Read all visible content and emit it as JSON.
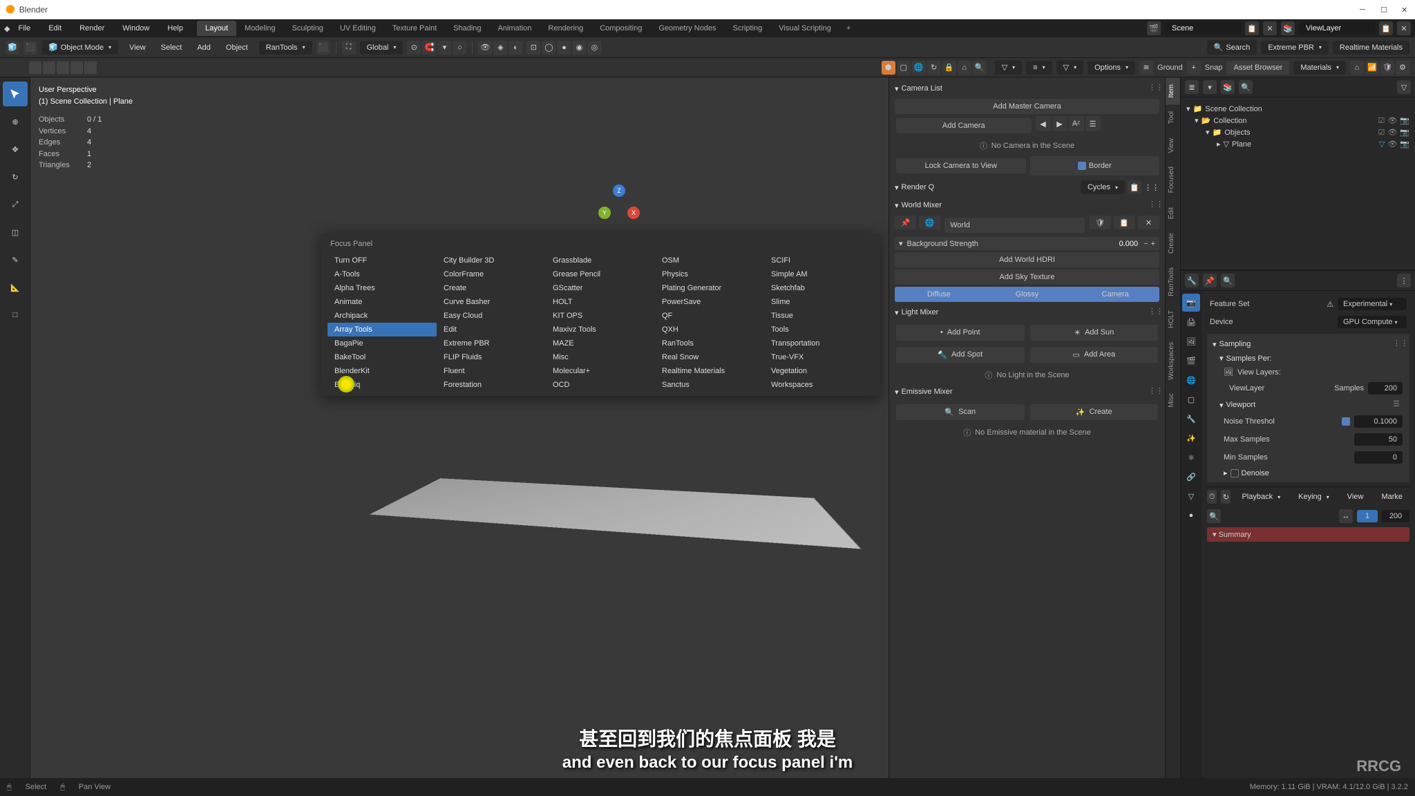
{
  "app": {
    "title": "Blender"
  },
  "menubar": [
    "File",
    "Edit",
    "Render",
    "Window",
    "Help"
  ],
  "workspace_tabs": [
    "Layout",
    "Modeling",
    "Sculpting",
    "UV Editing",
    "Texture Paint",
    "Shading",
    "Animation",
    "Rendering",
    "Compositing",
    "Geometry Nodes",
    "Scripting",
    "Visual Scripting"
  ],
  "workspace_active": 0,
  "scene_name": "Scene",
  "viewlayer_name": "ViewLayer",
  "toolbar": {
    "mode": "Object Mode",
    "menus": [
      "View",
      "Select",
      "Add",
      "Object"
    ],
    "rantools": "RanTools",
    "orientation": "Global",
    "search": "Search",
    "extreme_pbr": "Extreme PBR",
    "realtime_materials": "Realtime Materials"
  },
  "toolbar2": {
    "options": "Options",
    "ground": "Ground",
    "snap": "Snap",
    "asset_browser": "Asset Browser",
    "materials": "Materials"
  },
  "viewport": {
    "perspective": "User Perspective",
    "context": "(1) Scene Collection | Plane",
    "stats": {
      "objects_label": "Objects",
      "objects": "0 / 1",
      "vertices_label": "Vertices",
      "vertices": "4",
      "edges_label": "Edges",
      "edges": "4",
      "faces_label": "Faces",
      "faces": "1",
      "triangles_label": "Triangles",
      "triangles": "2"
    },
    "gizmo": {
      "x": "X",
      "y": "Y",
      "z": "Z"
    }
  },
  "focus_panel": {
    "title": "Focus Panel",
    "items": [
      "Turn OFF",
      "City Builder 3D",
      "Grassblade",
      "OSM",
      "SCIFI",
      "A-Tools",
      "ColorFrame",
      "Grease Pencil",
      "Physics",
      "Simple AM",
      "Alpha Trees",
      "Create",
      "GScatter",
      "Plating Generator",
      "Sketchfab",
      "Animate",
      "Curve Basher",
      "HOLT",
      "PowerSave",
      "Slime",
      "Archipack",
      "Easy Cloud",
      "KIT OPS",
      "QF",
      "Tissue",
      "Array Tools",
      "Edit",
      "Maxivz Tools",
      "QXH",
      "Tools",
      "BagaPie",
      "Extreme PBR",
      "MAZE",
      "RanTools",
      "Transportation",
      "BakeTool",
      "FLIP Fluids",
      "Misc",
      "Real Snow",
      "True-VFX",
      "BlenderKit",
      "Fluent",
      "Molecular+",
      "Realtime Materials",
      "Vegetation",
      "Botaniq",
      "Forestation",
      "OCD",
      "Sanctus",
      "Workspaces"
    ],
    "selected_index": 25
  },
  "npanel": {
    "camera_list": "Camera List",
    "add_master_camera": "Add Master Camera",
    "add_camera": "Add Camera",
    "no_camera": "No Camera in the Scene",
    "lock_camera": "Lock Camera to View",
    "border": "Border",
    "render_q": "Render Q",
    "render_engine": "Cycles",
    "world_mixer": "World Mixer",
    "world_name": "World",
    "bg_strength_label": "Background Strength",
    "bg_strength_value": "0.000",
    "add_world_hdri": "Add World HDRI",
    "add_sky_texture": "Add Sky Texture",
    "diffuse": "Diffuse",
    "glossy": "Glossy",
    "camera": "Camera",
    "light_mixer": "Light Mixer",
    "add_point": "Add Point",
    "add_sun": "Add Sun",
    "add_spot": "Add Spot",
    "add_area": "Add Area",
    "no_light": "No Light in the Scene",
    "emissive_mixer": "Emissive Mixer",
    "scan": "Scan",
    "create": "Create",
    "no_emissive": "No Emissive material in the Scene"
  },
  "vtabs": [
    "Item",
    "Tool",
    "View",
    "Focused",
    "Edit",
    "Create",
    "RanTools",
    "HOLT",
    "Workspaces",
    "Misc"
  ],
  "outliner": {
    "root": "Scene Collection",
    "collection": "Collection",
    "objects": "Objects",
    "plane": "Plane"
  },
  "properties": {
    "feature_set_label": "Feature Set",
    "feature_set": "Experimental",
    "device_label": "Device",
    "device": "GPU Compute",
    "sampling": "Sampling",
    "samples_per": "Samples Per:",
    "view_layers": "View Layers:",
    "viewlayer": "ViewLayer",
    "samples_label": "Samples",
    "samples": "200",
    "viewport_label": "Viewport",
    "noise_threshold_label": "Noise Threshol",
    "noise_threshold": "0.1000",
    "max_samples_label": "Max Samples",
    "max_samples": "50",
    "min_samples_label": "Min Samples",
    "min_samples": "0",
    "denoise": "Denoise"
  },
  "timeline": {
    "playback": "Playback",
    "keying": "Keying",
    "view": "View",
    "marker": "Marke",
    "frame": "1",
    "end": "200",
    "summary": "Summary"
  },
  "footer": {
    "select": "Select",
    "pan": "Pan View",
    "mem": "Memory: 1.11 GiB | VRAM: 4.1/12.0 GiB | 3.2.2"
  },
  "subtitles": {
    "cn": "甚至回到我们的焦点面板 我是",
    "en": "and even back to our focus panel i'm"
  },
  "logo": "RRCG"
}
